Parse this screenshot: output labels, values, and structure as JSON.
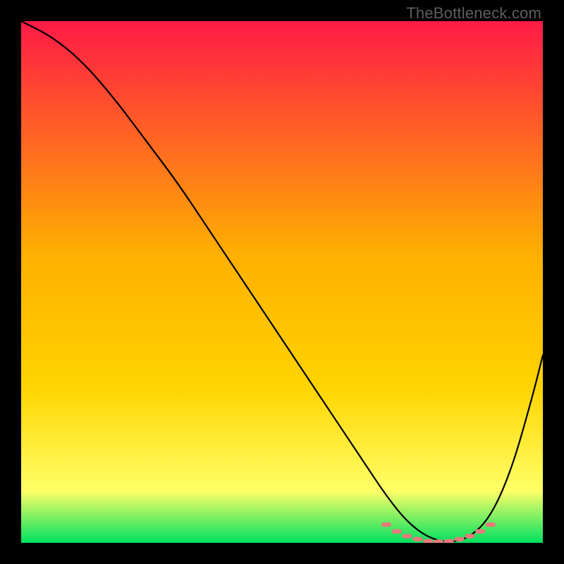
{
  "watermark": "TheBottleneck.com",
  "chart_data": {
    "type": "line",
    "title": "",
    "xlabel": "",
    "ylabel": "",
    "xlim": [
      0,
      100
    ],
    "ylim": [
      0,
      100
    ],
    "grid": false,
    "legend": false,
    "background_gradient": {
      "top_color": "#ff1a46",
      "mid_color": "#ffd400",
      "lower_color": "#ffff66",
      "bottom_color": "#00e060"
    },
    "series": [
      {
        "name": "bottleneck-curve",
        "color": "#000000",
        "x": [
          0,
          6,
          12,
          18,
          24,
          30,
          36,
          42,
          48,
          54,
          60,
          66,
          70,
          74,
          78,
          82,
          86,
          90,
          94,
          98,
          100
        ],
        "y": [
          100,
          97,
          92,
          85,
          77,
          69,
          60,
          51,
          42,
          33,
          24,
          15,
          9,
          4,
          1,
          0,
          1,
          5,
          14,
          28,
          36
        ]
      },
      {
        "name": "optimal-range-marker",
        "color": "#e77a7a",
        "style": "dotted-thick",
        "x": [
          70,
          72,
          74,
          76,
          78,
          80,
          82,
          84,
          86,
          88,
          90
        ],
        "y": [
          3.5,
          2.2,
          1.3,
          0.7,
          0.3,
          0.2,
          0.3,
          0.7,
          1.3,
          2.2,
          3.5
        ]
      }
    ]
  }
}
